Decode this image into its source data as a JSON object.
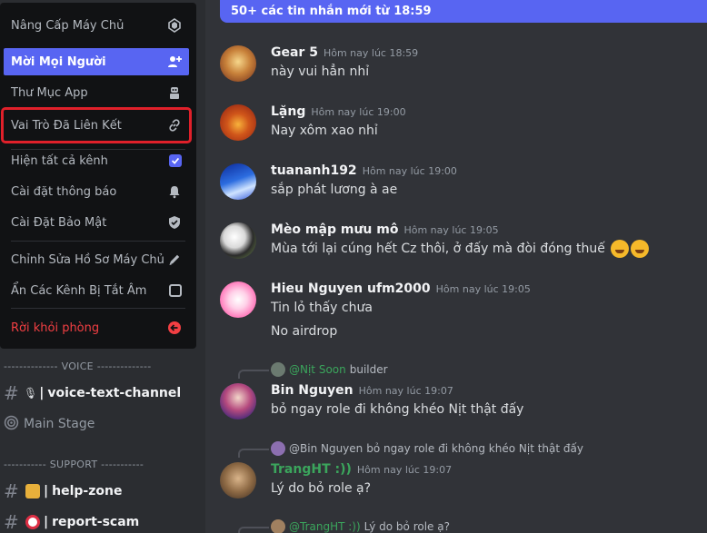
{
  "menu": {
    "items": [
      {
        "label": "Nâng Cấp Máy Chủ",
        "icon": "boost-gem-icon"
      },
      {
        "label": "Mời Mọi Người",
        "icon": "add-user-icon"
      },
      {
        "label": "Thư Mục App",
        "icon": "robot-icon"
      },
      {
        "label": "Vai Trò Đã Liên Kết",
        "icon": "link-icon"
      },
      {
        "label": "Hiện tất cả kênh",
        "icon": "checkbox-checked-icon"
      },
      {
        "label": "Cài đặt thông báo",
        "icon": "bell-icon"
      },
      {
        "label": "Cài Đặt Bảo Mật",
        "icon": "shield-icon"
      },
      {
        "label": "Chỉnh Sửa Hồ Sơ Máy Chủ",
        "icon": "pencil-icon"
      },
      {
        "label": "Ẩn Các Kênh Bị Tắt Âm",
        "icon": "checkbox-empty-icon"
      },
      {
        "label": "Rời khỏi phòng",
        "icon": "leave-icon"
      }
    ]
  },
  "channels": {
    "voice_category": "-------------- VOICE --------------",
    "voice_text": "voice-text-channel",
    "main_stage": "Main Stage",
    "support_category": "----------- SUPPORT -----------",
    "help_zone": "help-zone",
    "report_scam": "report-scam",
    "divider_char": "|"
  },
  "chat": {
    "new_messages_bar": "50+ các tin nhắn mới từ 18:59",
    "messages": [
      {
        "author": "Gear 5",
        "time": "Hôm nay lúc 18:59",
        "lines": [
          "này vui hẳn nhỉ"
        ]
      },
      {
        "author": "Lặng",
        "time": "Hôm nay lúc 19:00",
        "lines": [
          "Nay xôm xao nhỉ"
        ]
      },
      {
        "author": "tuananh192",
        "time": "Hôm nay lúc 19:00",
        "lines": [
          "sắp phát lương à ae"
        ]
      },
      {
        "author": "Mèo mập mưu mô",
        "time": "Hôm nay lúc 19:05",
        "lines": [
          "Mùa tới lại cúng hết Cz thôi, ở đấy mà đòi đóng thuế"
        ]
      },
      {
        "author": "Hieu Nguyen ufm2000",
        "time": "Hôm nay lúc 19:05",
        "lines": [
          "Tin lỏ thấy chưa",
          "No airdrop"
        ]
      },
      {
        "reply_name": "@Nịt Soon",
        "reply_text": "builder",
        "author": "Bin Nguyen",
        "time": "Hôm nay lúc 19:07",
        "lines": [
          "bỏ ngay role đi không khéo Nịt thật đấy"
        ]
      },
      {
        "reply_name": "@Bin Nguyen",
        "reply_text": "bỏ ngay role đi không khéo Nịt thật đấy",
        "author": "TrangHT :))",
        "time": "Hôm nay lúc 19:07",
        "lines": [
          "Lý do bỏ role ạ?"
        ]
      },
      {
        "reply_name": "@TrangHT :))",
        "reply_text": "Lý do bỏ role ạ?"
      }
    ]
  },
  "colors": {
    "accent": "#5865f2",
    "highlight_outline": "#e0202a",
    "danger": "#f23f43",
    "green_name": "#3ba55c"
  }
}
